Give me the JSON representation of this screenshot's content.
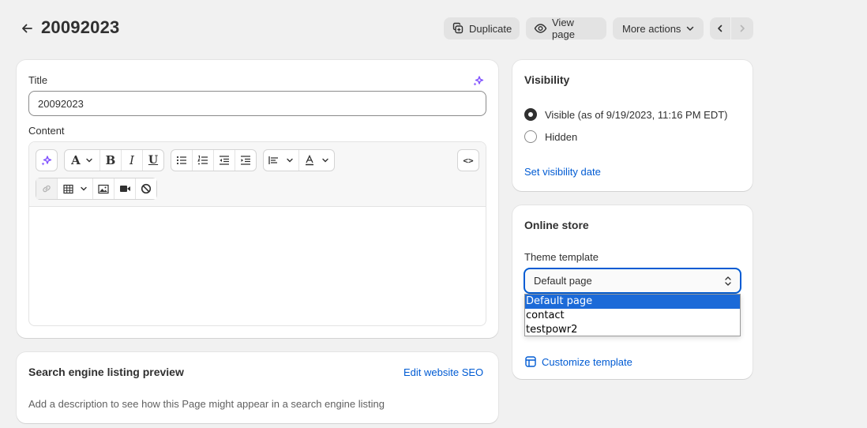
{
  "header": {
    "title": "20092023",
    "duplicate_label": "Duplicate",
    "view_page_label": "View page",
    "more_actions_label": "More actions"
  },
  "main": {
    "title_label": "Title",
    "title_value": "20092023",
    "content_label": "Content",
    "toolbar_icons": [
      "magic-icon",
      "text-style-icon",
      "bold-icon",
      "italic-icon",
      "underline-icon",
      "bullet-list-icon",
      "numbered-list-icon",
      "outdent-icon",
      "indent-icon",
      "align-icon",
      "text-color-icon",
      "code-icon",
      "link-icon",
      "table-icon",
      "image-icon",
      "video-icon",
      "clear-format-icon"
    ],
    "bold_glyph": "B",
    "italic_glyph": "I",
    "underline_glyph": "U",
    "font_glyph": "A",
    "code_glyph": "<>"
  },
  "seo": {
    "title": "Search engine listing preview",
    "edit_link": "Edit website SEO",
    "description": "Add a description to see how this Page might appear in a search engine listing"
  },
  "visibility": {
    "title": "Visibility",
    "options": [
      {
        "label": "Visible (as of 9/19/2023, 11:16 PM EDT)",
        "checked": true
      },
      {
        "label": "Hidden",
        "checked": false
      }
    ],
    "set_date_link": "Set visibility date"
  },
  "online_store": {
    "title": "Online store",
    "theme_template_label": "Theme template",
    "selected_value": "Default page",
    "options": [
      "Default page",
      "contact",
      "testpowr2"
    ],
    "customize_link": "Customize template"
  },
  "colors": {
    "accent": "#005bd3",
    "magic": "#8051ff",
    "selected_option": "#1b6ad8"
  }
}
